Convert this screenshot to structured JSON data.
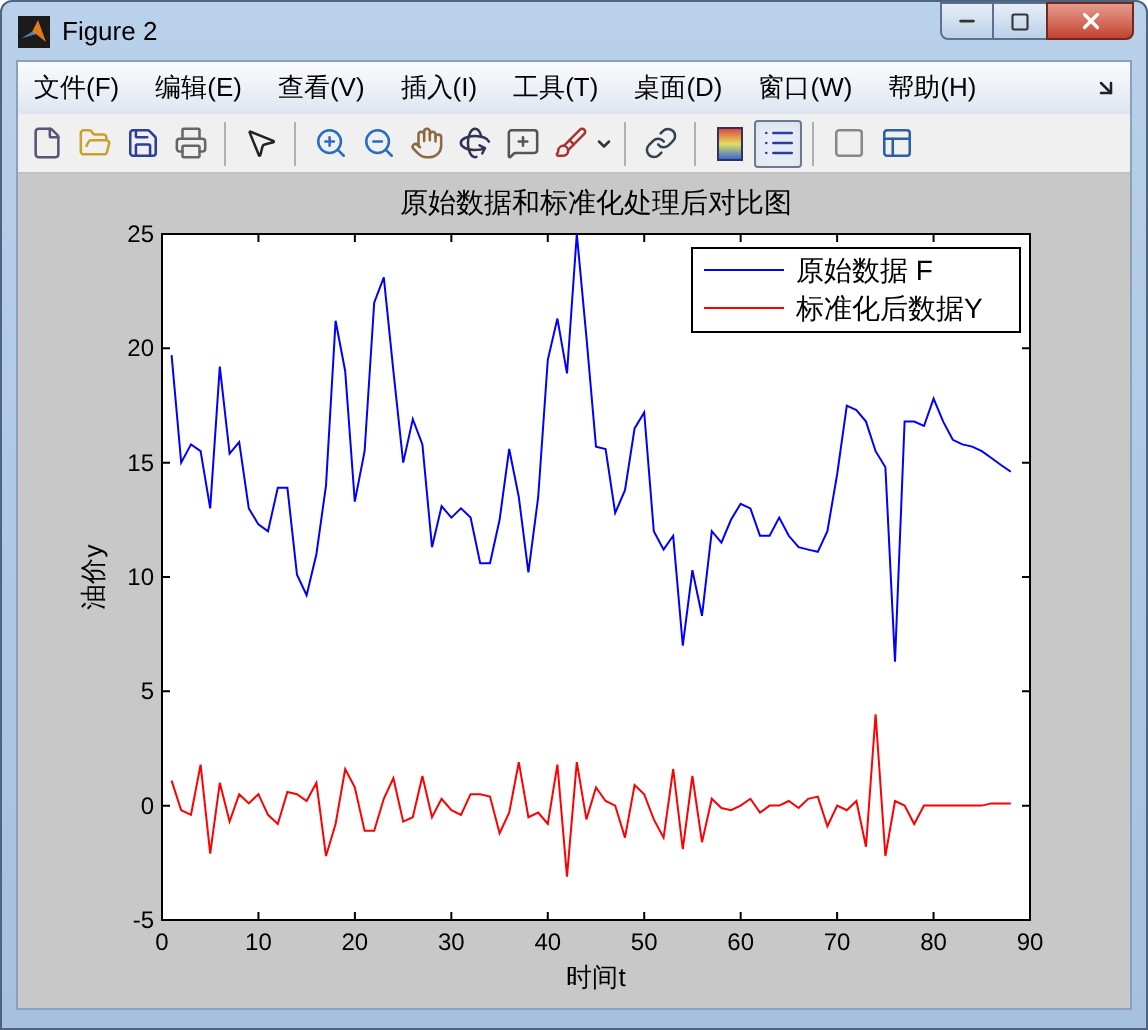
{
  "window": {
    "title": "Figure 2"
  },
  "menu": [
    "文件(F)",
    "编辑(E)",
    "查看(V)",
    "插入(I)",
    "工具(T)",
    "桌面(D)",
    "窗口(W)",
    "帮助(H)"
  ],
  "toolbar": [
    [
      {
        "kind": "new",
        "pressed": false
      },
      {
        "kind": "open",
        "pressed": false
      },
      {
        "kind": "save",
        "pressed": false
      },
      {
        "kind": "print",
        "pressed": false
      }
    ],
    [
      {
        "kind": "pointer",
        "pressed": false
      }
    ],
    [
      {
        "kind": "zoom-in",
        "pressed": false
      },
      {
        "kind": "zoom-out",
        "pressed": false
      },
      {
        "kind": "pan",
        "pressed": false
      },
      {
        "kind": "rotate",
        "pressed": false
      },
      {
        "kind": "data-cursor",
        "pressed": false
      },
      {
        "kind": "brush",
        "pressed": false
      }
    ],
    [
      {
        "kind": "link",
        "pressed": false
      }
    ],
    [
      {
        "kind": "colorbar",
        "pressed": false
      },
      {
        "kind": "legend",
        "pressed": true
      }
    ],
    [
      {
        "kind": "hide-tools",
        "pressed": false
      },
      {
        "kind": "show-tools",
        "pressed": false
      }
    ]
  ],
  "figure": {
    "chart_data": {
      "type": "line",
      "title": "原始数据和标准化处理后对比图",
      "xlabel": "时间t",
      "ylabel": "油价y",
      "x": [
        1,
        2,
        3,
        4,
        5,
        6,
        7,
        8,
        9,
        10,
        11,
        12,
        13,
        14,
        15,
        16,
        17,
        18,
        19,
        20,
        21,
        22,
        23,
        24,
        25,
        26,
        27,
        28,
        29,
        30,
        31,
        32,
        33,
        34,
        35,
        36,
        37,
        38,
        39,
        40,
        41,
        42,
        43,
        44,
        45,
        46,
        47,
        48,
        49,
        50,
        51,
        52,
        53,
        54,
        55,
        56,
        57,
        58,
        59,
        60,
        61,
        62,
        63,
        64,
        65,
        66,
        67,
        68,
        69,
        70,
        71,
        72,
        73,
        74,
        75,
        76,
        77,
        78,
        79,
        80,
        81,
        82,
        83,
        84,
        85,
        86,
        87,
        88
      ],
      "series": [
        {
          "name": "原始数据 F",
          "color": "#0000ff",
          "values": [
            19.7,
            15.0,
            15.8,
            15.5,
            13.0,
            19.2,
            15.4,
            15.9,
            13.0,
            12.3,
            12.0,
            13.9,
            13.9,
            10.1,
            9.2,
            11.0,
            14.0,
            21.2,
            19.0,
            13.3,
            15.5,
            22.0,
            23.1,
            19.0,
            15.0,
            16.9,
            15.8,
            11.3,
            13.1,
            12.6,
            13.0,
            12.6,
            10.6,
            10.6,
            12.5,
            15.6,
            13.5,
            10.2,
            13.5,
            19.5,
            21.3,
            18.9,
            25.0,
            20.5,
            15.7,
            15.6,
            12.8,
            13.8,
            16.5,
            17.2,
            12.0,
            11.2,
            11.8,
            7.0,
            10.3,
            8.3,
            12.0,
            11.5,
            12.5,
            13.2,
            13.0,
            11.8,
            11.8,
            12.6,
            11.8,
            11.3,
            11.2,
            11.1,
            12.0,
            14.5,
            17.5,
            17.3,
            16.8,
            15.5,
            14.8,
            6.3,
            16.8,
            16.8,
            16.6,
            17.8,
            16.8,
            16.0,
            15.8,
            15.7,
            15.5,
            15.2,
            14.9,
            14.6
          ]
        },
        {
          "name": "标准化后数据Y",
          "color": "#ff0000",
          "values": [
            1.1,
            -0.2,
            -0.4,
            1.8,
            -2.1,
            1.0,
            -0.7,
            0.5,
            0.1,
            0.5,
            -0.4,
            -0.8,
            0.6,
            0.5,
            0.2,
            1.0,
            -2.2,
            -0.8,
            1.6,
            0.8,
            -1.1,
            -1.1,
            0.3,
            1.2,
            -0.7,
            -0.5,
            1.3,
            -0.5,
            0.3,
            -0.2,
            -0.4,
            0.5,
            0.5,
            0.4,
            -1.2,
            -0.3,
            1.9,
            -0.5,
            -0.3,
            -0.8,
            1.8,
            -3.1,
            1.9,
            -0.6,
            0.8,
            0.2,
            0.0,
            -1.4,
            0.9,
            0.5,
            -0.6,
            -1.4,
            1.6,
            -1.9,
            1.3,
            -1.6,
            0.3,
            -0.1,
            -0.2,
            0.0,
            0.3,
            -0.3,
            0.0,
            0.0,
            0.2,
            -0.1,
            0.3,
            0.4,
            -0.9,
            0.0,
            -0.2,
            0.2,
            -1.8,
            4.0,
            -2.2,
            0.2,
            0.0,
            -0.8,
            0.0,
            0.0,
            0.0,
            0.0,
            0.0,
            0.0,
            0.0,
            0.1,
            0.1,
            0.1
          ]
        }
      ],
      "legend": true,
      "xlim": [
        0,
        90
      ],
      "ylim": [
        -5,
        25
      ],
      "xticks": [
        0,
        10,
        20,
        30,
        40,
        50,
        60,
        70,
        80,
        90
      ],
      "yticks": [
        -5,
        0,
        5,
        10,
        15,
        20,
        25
      ]
    }
  }
}
